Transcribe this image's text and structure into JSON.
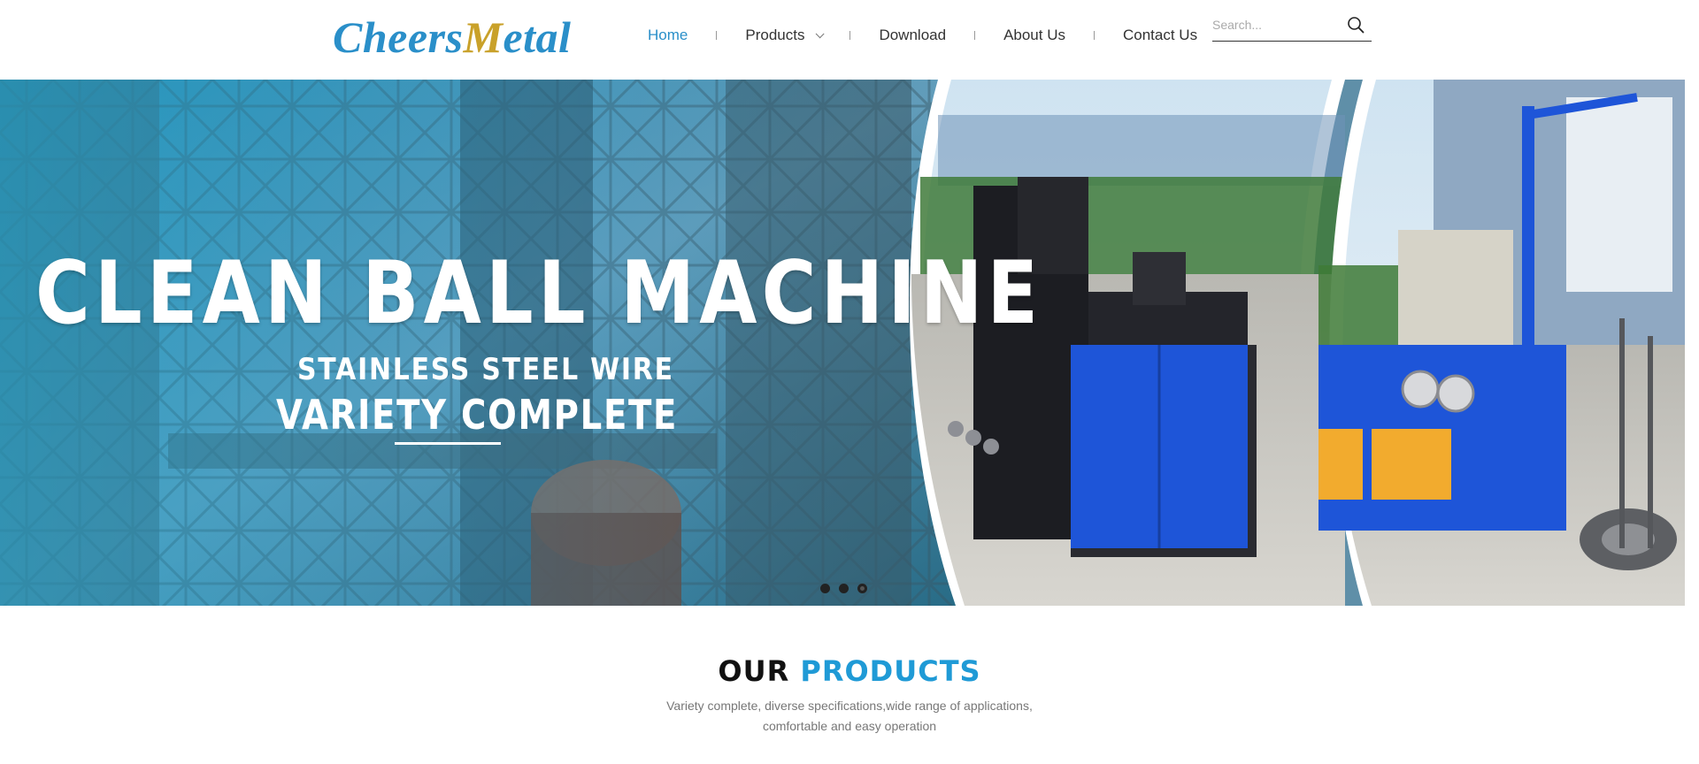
{
  "brand": {
    "logo_part1": "Cheers",
    "logo_part2": "M",
    "logo_part3": "etal"
  },
  "nav": {
    "home": "Home",
    "products": "Products",
    "download": "Download",
    "about": "About Us",
    "contact": "Contact Us"
  },
  "search": {
    "placeholder": "Search..."
  },
  "banner": {
    "title": "CLEAN BALL MACHINE",
    "subtitle1": "STAINLESS STEEL WIRE",
    "subtitle2": "VARIETY COMPLETE",
    "slide_count": 3,
    "active_slide": 3
  },
  "products": {
    "title_word1": "OUR",
    "title_word2": "PRODUCTS",
    "desc_line1": "Variety complete, diverse specifications,wide range of applications,",
    "desc_line2": "comfortable and easy operation"
  },
  "colors": {
    "accent": "#1f9ad6",
    "logo_blue": "#2a8fc9",
    "logo_gold": "#c9a12a",
    "machine_blue": "#1e55d8"
  },
  "icons": {
    "search": "search-icon",
    "products_dropdown": "chevron-down-icon"
  }
}
